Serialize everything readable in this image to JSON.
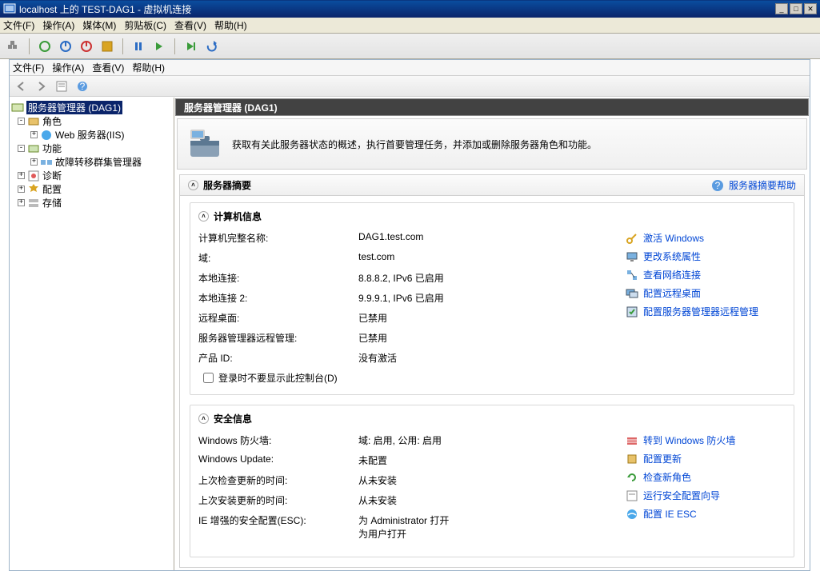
{
  "titlebar": {
    "text": "localhost 上的 TEST-DAG1 - 虚拟机连接"
  },
  "outer_menu": [
    "文件(F)",
    "操作(A)",
    "媒体(M)",
    "剪贴板(C)",
    "查看(V)",
    "帮助(H)"
  ],
  "inner_menu": [
    "文件(F)",
    "操作(A)",
    "查看(V)",
    "帮助(H)"
  ],
  "header_title": "服务器管理器 (DAG1)",
  "intro": "获取有关此服务器状态的概述，执行首要管理任务，并添加或删除服务器角色和功能。",
  "summary": {
    "title": "服务器摘要",
    "help": "服务器摘要帮助"
  },
  "tree": {
    "root": "服务器管理器 (DAG1)",
    "roles": "角色",
    "iis": "Web 服务器(IIS)",
    "features": "功能",
    "failover": "故障转移群集管理器",
    "diag": "诊断",
    "config": "配置",
    "storage": "存储"
  },
  "computer": {
    "title": "计算机信息",
    "rows": [
      {
        "k": "计算机完整名称:",
        "v": "DAG1.test.com"
      },
      {
        "k": "域:",
        "v": "test.com"
      },
      {
        "k": "本地连接:",
        "v": "8.8.8.2, IPv6 已启用"
      },
      {
        "k": "本地连接 2:",
        "v": "9.9.9.1, IPv6 已启用"
      },
      {
        "k": "远程桌面:",
        "v": "已禁用"
      },
      {
        "k": "服务器管理器远程管理:",
        "v": "已禁用"
      },
      {
        "k": "产品 ID:",
        "v": "没有激活"
      }
    ],
    "checkbox": "登录时不要显示此控制台(D)",
    "links": [
      "激活 Windows",
      "更改系统属性",
      "查看网络连接",
      "配置远程桌面",
      "配置服务器管理器远程管理"
    ]
  },
  "security": {
    "title": "安全信息",
    "rows": [
      {
        "k": "Windows 防火墙:",
        "v": "域: 启用, 公用: 启用"
      },
      {
        "k": "Windows Update:",
        "v": "未配置"
      },
      {
        "k": "上次检查更新的时间:",
        "v": "从未安装"
      },
      {
        "k": "上次安装更新的时间:",
        "v": "从未安装"
      },
      {
        "k": "IE 增强的安全配置(ESC):",
        "v": "为 Administrator 打开\n为用户打开"
      }
    ],
    "links": [
      "转到 Windows 防火墙",
      "配置更新",
      "检查新角色",
      "运行安全配置向导",
      "配置 IE ESC"
    ]
  }
}
